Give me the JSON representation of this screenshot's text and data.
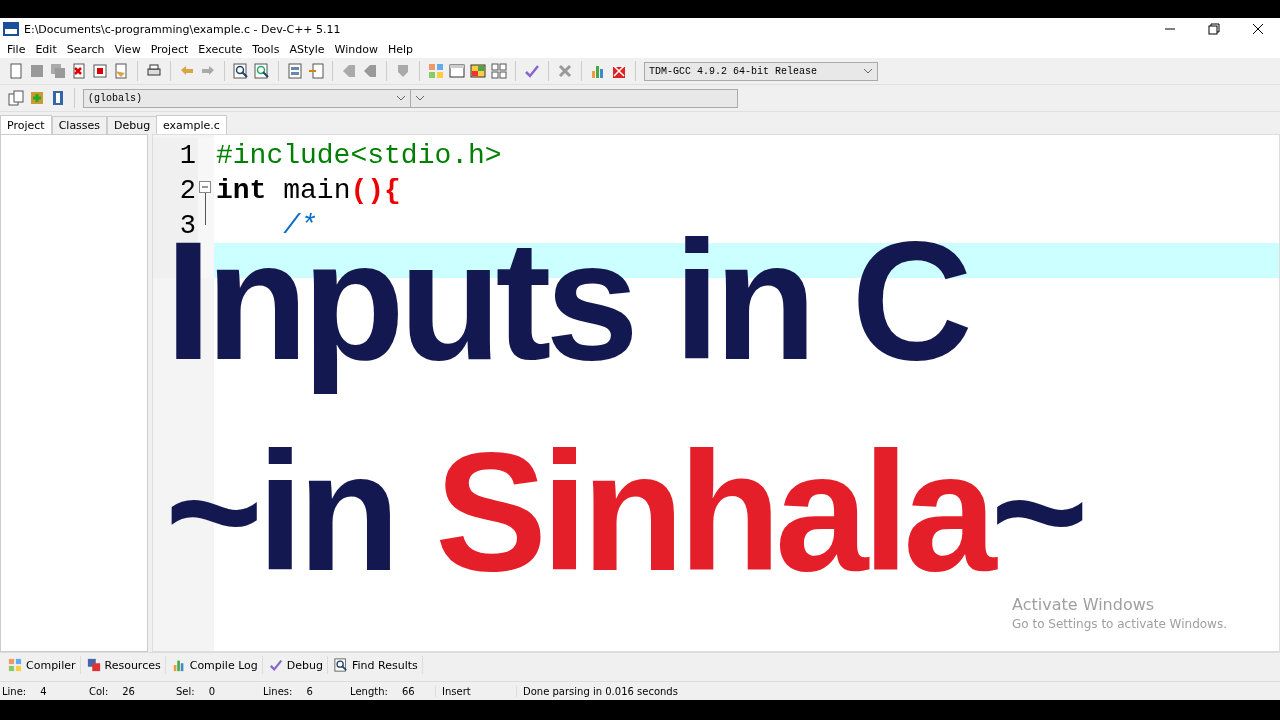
{
  "window": {
    "title": "E:\\Documents\\c-programming\\example.c - Dev-C++ 5.11"
  },
  "menu": [
    "File",
    "Edit",
    "Search",
    "View",
    "Project",
    "Execute",
    "Tools",
    "AStyle",
    "Window",
    "Help"
  ],
  "compiler_select": {
    "value": "TDM-GCC 4.9.2 64-bit Release"
  },
  "scope_select": {
    "value": "(globals)"
  },
  "left_tabs": [
    {
      "label": "Project",
      "selected": true
    },
    {
      "label": "Classes",
      "selected": false
    },
    {
      "label": "Debug",
      "selected": false
    }
  ],
  "editor_tabs": [
    {
      "label": "example.c",
      "selected": true
    }
  ],
  "code_lines": [
    {
      "number": "1",
      "current": false,
      "segments": [
        {
          "kind": "preprocessor",
          "text": "#include<stdio.h>"
        }
      ]
    },
    {
      "number": "2",
      "current": false,
      "segments": [
        {
          "kind": "keyword",
          "text": "int"
        },
        {
          "kind": "plain",
          "text": " main"
        },
        {
          "kind": "symbol",
          "text": "(){"
        }
      ]
    },
    {
      "number": "3",
      "current": false,
      "segments": [
        {
          "kind": "comment",
          "text": "    /*"
        }
      ]
    },
    {
      "current": true
    }
  ],
  "bottom_tabs": [
    {
      "label": "Compiler",
      "kind": "compiler"
    },
    {
      "label": "Resources",
      "kind": "resources"
    },
    {
      "label": "Compile Log",
      "kind": "log"
    },
    {
      "label": "Debug",
      "kind": "debug"
    },
    {
      "label": "Find Results",
      "kind": "find"
    }
  ],
  "status_bar": {
    "fields": [
      {
        "label": "Line:",
        "value": "4"
      },
      {
        "label": "Col:",
        "value": "26"
      },
      {
        "label": "Sel:",
        "value": "0"
      },
      {
        "label": "Lines:",
        "value": "6"
      },
      {
        "label": "Length:",
        "value": "66"
      }
    ],
    "mode": "Insert",
    "message": "Done parsing in 0.016 seconds"
  },
  "title_overlay": {
    "lines": [
      [
        {
          "text": "Inputs in C",
          "color": "#141850"
        }
      ],
      [
        {
          "text": "~in ",
          "color": "#141850"
        },
        {
          "text": "Sinhala",
          "color": "#e51f29"
        },
        {
          "text": "~",
          "color": "#141850"
        }
      ]
    ]
  },
  "activation_notice": {
    "title": "Activate Windows",
    "text": "Go to Settings to activate Windows."
  }
}
